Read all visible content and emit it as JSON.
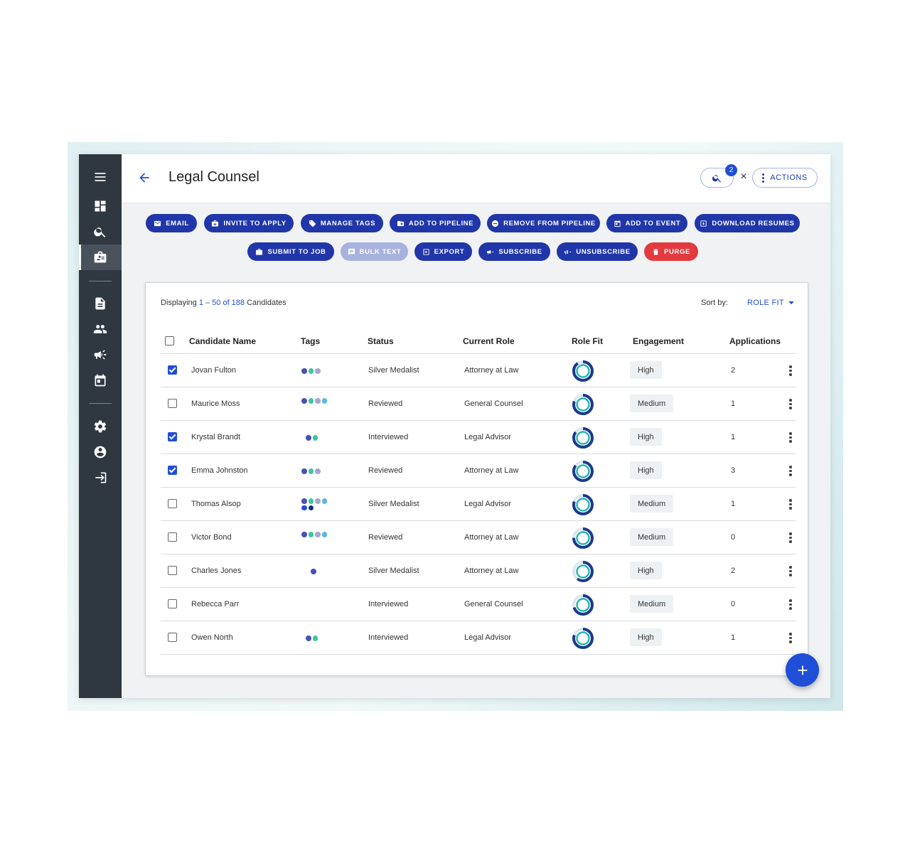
{
  "sidebar": {
    "icons": [
      "menu-icon",
      "dashboard-icon",
      "search-icon",
      "candidates-icon",
      "document-icon",
      "people-icon",
      "megaphone-icon",
      "calendar-icon",
      "gear-icon",
      "account-icon",
      "logout-icon"
    ]
  },
  "header": {
    "title": "Legal Counsel",
    "search_badge": "2",
    "clear": "×",
    "actions_label": "ACTIONS"
  },
  "toolbar": {
    "email": "EMAIL",
    "invite": "INVITE TO APPLY",
    "tags": "MANAGE TAGS",
    "add_pipeline": "ADD TO PIPELINE",
    "remove_pipeline": "REMOVE FROM PIPELINE",
    "add_event": "ADD TO EVENT",
    "download": "DOWNLOAD RESUMES",
    "submit_job": "SUBMIT TO JOB",
    "bulk_text": "BULK TEXT",
    "export": "EXPORT",
    "subscribe": "SUBSCRIBE",
    "unsubscribe": "UNSUBSCRIBE",
    "purge": "PURGE"
  },
  "listing": {
    "displaying": "Displaying",
    "range": "1 – 50 of 188",
    "suffix": "Candidates",
    "sort_label": "Sort by:",
    "sort_value": "ROLE FIT"
  },
  "table": {
    "columns": [
      "Candidate Name",
      "Tags",
      "Status",
      "Current Role",
      "Role Fit",
      "Engagement",
      "Applications"
    ],
    "rows": [
      {
        "checked": true,
        "name": "Jovan Fulton",
        "tags": [
          "#4a51b8",
          "#3cc6a6",
          "#a7a8c9"
        ],
        "status": "Silver Medalist",
        "role": "Attorney at Law",
        "fit": 0.9,
        "engagement": "High",
        "applications": "2"
      },
      {
        "checked": false,
        "name": "Maurice Moss",
        "tags": [
          "#4a51b8",
          "#3cc6a6",
          "#a7a8c9",
          "#5ab6e8"
        ],
        "status": "Reviewed",
        "role": "General Counsel",
        "fit": 0.8,
        "engagement": "Medium",
        "applications": "1"
      },
      {
        "checked": true,
        "name": "Krystal Brandt",
        "tags": [
          "#4a51b8",
          "#3cc6a6"
        ],
        "status": "Interviewed",
        "role": "Legal Advisor",
        "fit": 0.85,
        "engagement": "High",
        "applications": "1"
      },
      {
        "checked": true,
        "name": "Emma Johnston",
        "tags": [
          "#4a51b8",
          "#3cc6a6",
          "#a7a8c9"
        ],
        "status": "Reviewed",
        "role": "Attorney at Law",
        "fit": 0.85,
        "engagement": "High",
        "applications": "3"
      },
      {
        "checked": false,
        "name": "Thomas Alsop",
        "tags": [
          "#4a51b8",
          "#3cc6a6",
          "#a7a8c9",
          "#5ab6e8",
          "#1f4fd6",
          "#1a2a7a"
        ],
        "status": "Silver Medalist",
        "role": "Legal Advisor",
        "fit": 0.8,
        "engagement": "Medium",
        "applications": "1"
      },
      {
        "checked": false,
        "name": "Victor Bond",
        "tags": [
          "#4a51b8",
          "#3cc6a6",
          "#a7a8c9",
          "#5ab6e8"
        ],
        "status": "Reviewed",
        "role": "Attorney at Law",
        "fit": 0.75,
        "engagement": "Medium",
        "applications": "0"
      },
      {
        "checked": false,
        "name": "Charles Jones",
        "tags": [
          "#4a51b8"
        ],
        "status": "Silver Medalist",
        "role": "Attorney at Law",
        "fit": 0.6,
        "engagement": "High",
        "applications": "2"
      },
      {
        "checked": false,
        "name": "Rebecca Parr",
        "tags": [],
        "status": "Interviewed",
        "role": "General Counsel",
        "fit": 0.7,
        "engagement": "Medium",
        "applications": "0"
      },
      {
        "checked": false,
        "name": "Owen North",
        "tags": [
          "#4a51b8",
          "#3cc6a6"
        ],
        "status": "Interviewed",
        "role": "Legal Advisor",
        "fit": 0.8,
        "engagement": "High",
        "applications": "1"
      }
    ]
  },
  "colors": {
    "primary": "#2136a8",
    "accent": "#1f4fd6",
    "danger": "#e23a3f",
    "sidebar": "#2f3741"
  }
}
